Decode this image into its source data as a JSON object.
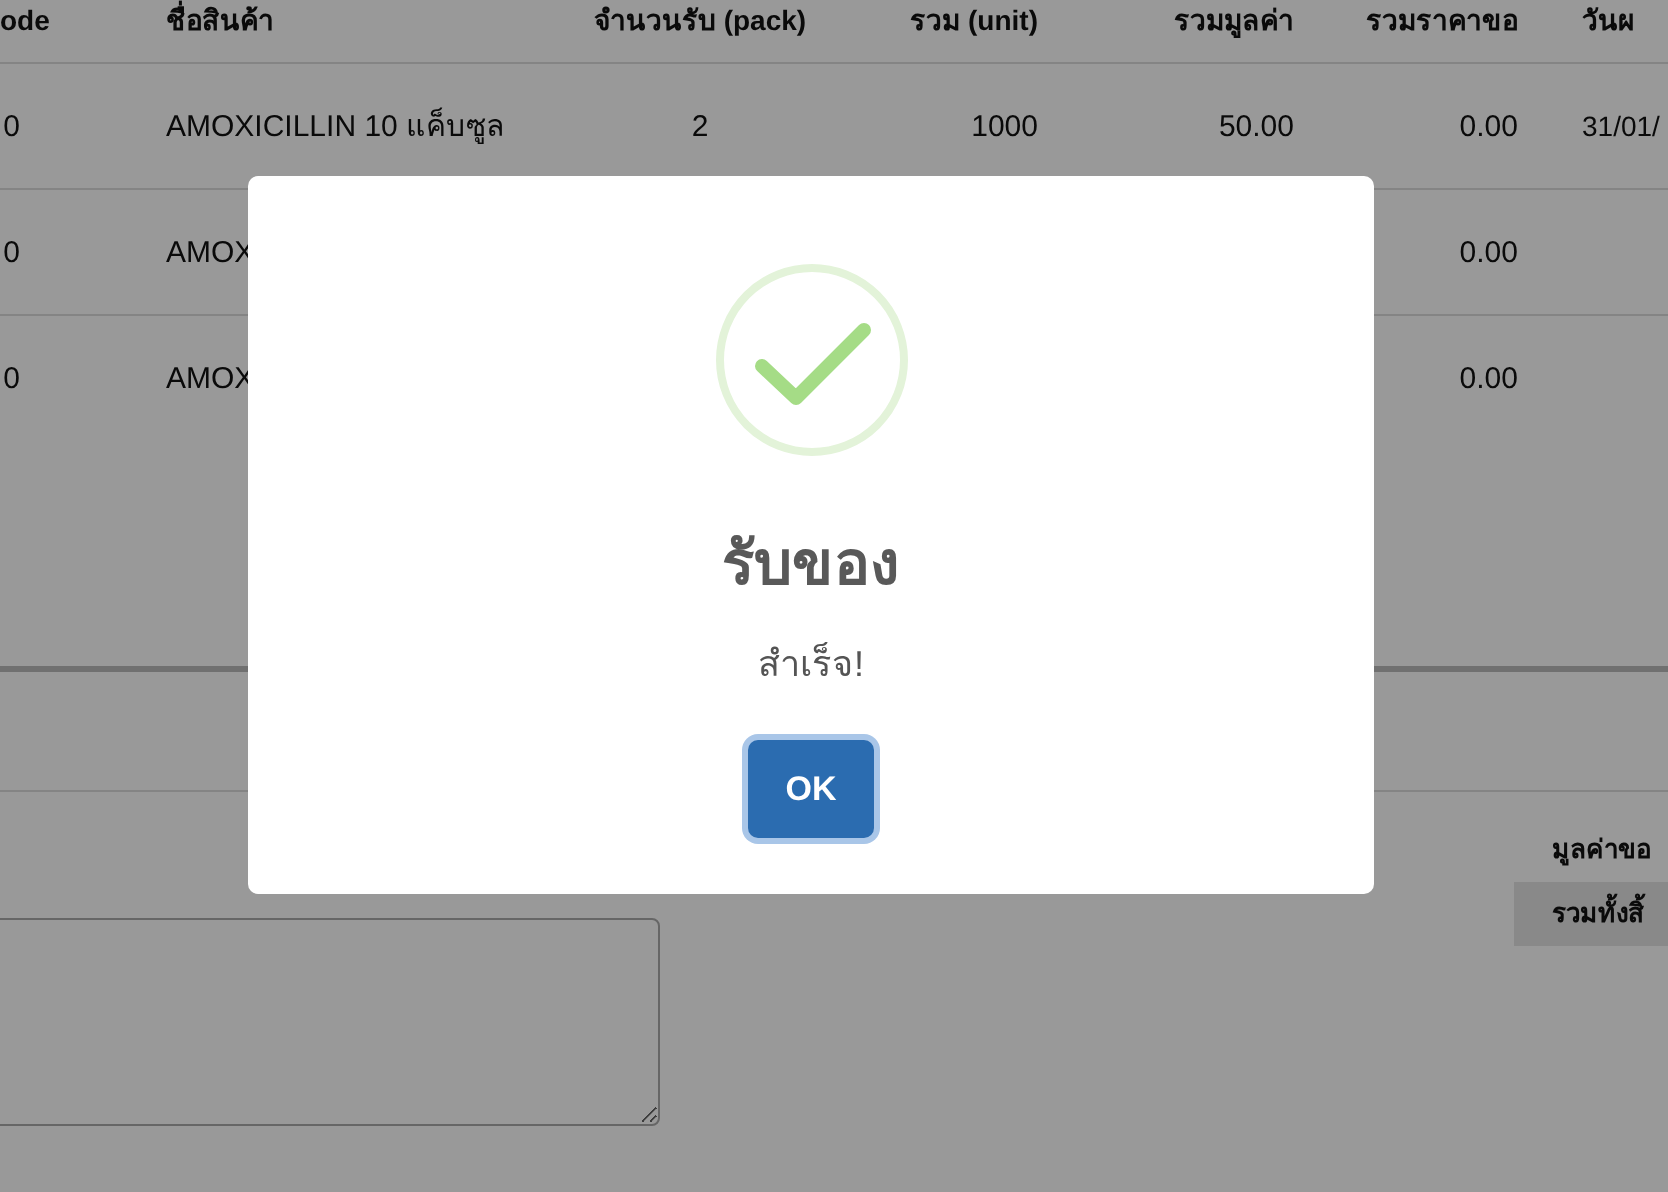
{
  "table": {
    "columns": [
      "ode",
      "ชื่อสินค้า",
      "จำนวนรับ (pack)",
      "รวม (unit)",
      "รวมมูลค่า",
      "รวมราคาขอ",
      "วันผ"
    ],
    "rows": [
      {
        "code": "0",
        "product": "AMOXICILLIN 10 แค็บซูล",
        "qty_pack": "2",
        "qty_unit": "1000",
        "total_value": "50.00",
        "column_6": "0.00",
        "date": "31/01/"
      },
      {
        "code": "0",
        "product": "AMOX",
        "column_6": "0.00"
      },
      {
        "code": "0",
        "product": "AMOX",
        "column_6": "0.00"
      }
    ]
  },
  "summary": [
    {
      "label": "มูลค่าขอ",
      "highlighted": false
    },
    {
      "label": "รวมทั้งสิ้",
      "highlighted": true
    }
  ],
  "dialog": {
    "kind": "success",
    "title": "รับของ",
    "message": "สำเร็จ!",
    "button": "OK"
  }
}
